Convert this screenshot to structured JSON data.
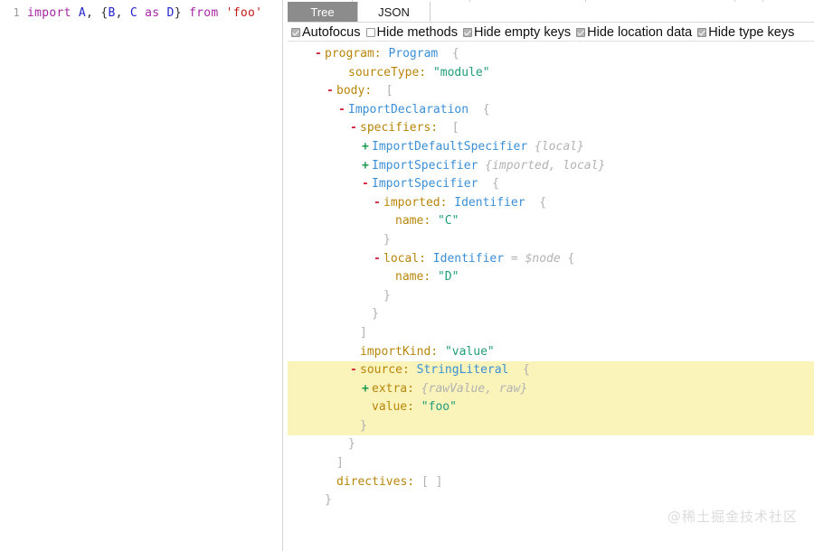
{
  "editor": {
    "lines": [
      {
        "number": "1",
        "tokens": [
          {
            "t": "import",
            "c": "kw"
          },
          {
            "t": " ",
            "c": "plain"
          },
          {
            "t": "A",
            "c": "id"
          },
          {
            "t": ", ",
            "c": "punc"
          },
          {
            "t": "{",
            "c": "punc"
          },
          {
            "t": "B",
            "c": "id"
          },
          {
            "t": ", ",
            "c": "punc"
          },
          {
            "t": "C",
            "c": "id"
          },
          {
            "t": " ",
            "c": "plain"
          },
          {
            "t": "as",
            "c": "kw"
          },
          {
            "t": " ",
            "c": "plain"
          },
          {
            "t": "D",
            "c": "id"
          },
          {
            "t": "}",
            "c": "punc"
          },
          {
            "t": " ",
            "c": "plain"
          },
          {
            "t": "from",
            "c": "kw"
          },
          {
            "t": " ",
            "c": "plain"
          },
          {
            "t": "'foo'",
            "c": "str"
          }
        ],
        "plain": "import A, {B, C as D} from 'foo'"
      }
    ]
  },
  "ast_panel": {
    "tabs": [
      {
        "label": "Tree",
        "active": true
      },
      {
        "label": "JSON",
        "active": false
      }
    ],
    "options": [
      {
        "label": "Autofocus",
        "checked": true
      },
      {
        "label": "Hide methods",
        "checked": false
      },
      {
        "label": "Hide empty keys",
        "checked": true
      },
      {
        "label": "Hide location data",
        "checked": true
      },
      {
        "label": "Hide type keys",
        "checked": true
      }
    ],
    "tree": [
      {
        "indent": 0,
        "toggle": "-",
        "parts": [
          {
            "t": "program",
            "c": "key"
          },
          {
            "t": ":",
            "c": "colon"
          },
          {
            "t": " ",
            "c": "plain"
          },
          {
            "t": "Program",
            "c": "type"
          },
          {
            "t": "  ",
            "c": "plain"
          },
          {
            "t": "{",
            "c": "brace"
          }
        ],
        "highlight": false
      },
      {
        "indent": 2,
        "toggle": " ",
        "parts": [
          {
            "t": "sourceType",
            "c": "key"
          },
          {
            "t": ":",
            "c": "colon"
          },
          {
            "t": " ",
            "c": "plain"
          },
          {
            "t": "\"module\"",
            "c": "str"
          }
        ],
        "highlight": false
      },
      {
        "indent": 1,
        "toggle": "-",
        "parts": [
          {
            "t": "body",
            "c": "key"
          },
          {
            "t": ":",
            "c": "colon"
          },
          {
            "t": "  ",
            "c": "plain"
          },
          {
            "t": "[",
            "c": "brace"
          }
        ],
        "highlight": false
      },
      {
        "indent": 2,
        "toggle": "-",
        "parts": [
          {
            "t": "ImportDeclaration",
            "c": "type"
          },
          {
            "t": "  ",
            "c": "plain"
          },
          {
            "t": "{",
            "c": "brace"
          }
        ],
        "highlight": false
      },
      {
        "indent": 3,
        "toggle": "-",
        "parts": [
          {
            "t": "specifiers",
            "c": "key"
          },
          {
            "t": ":",
            "c": "colon"
          },
          {
            "t": "  ",
            "c": "plain"
          },
          {
            "t": "[",
            "c": "brace"
          }
        ],
        "highlight": false
      },
      {
        "indent": 4,
        "toggle": "+",
        "parts": [
          {
            "t": "ImportDefaultSpecifier",
            "c": "type"
          },
          {
            "t": " ",
            "c": "plain"
          },
          {
            "t": "{local}",
            "c": "hint"
          }
        ],
        "highlight": false
      },
      {
        "indent": 4,
        "toggle": "+",
        "parts": [
          {
            "t": "ImportSpecifier",
            "c": "type"
          },
          {
            "t": " ",
            "c": "plain"
          },
          {
            "t": "{imported, local}",
            "c": "hint"
          }
        ],
        "highlight": false
      },
      {
        "indent": 4,
        "toggle": "-",
        "parts": [
          {
            "t": "ImportSpecifier",
            "c": "type"
          },
          {
            "t": "  ",
            "c": "plain"
          },
          {
            "t": "{",
            "c": "brace"
          }
        ],
        "highlight": false
      },
      {
        "indent": 5,
        "toggle": "-",
        "parts": [
          {
            "t": "imported",
            "c": "key"
          },
          {
            "t": ":",
            "c": "colon"
          },
          {
            "t": " ",
            "c": "plain"
          },
          {
            "t": "Identifier",
            "c": "type"
          },
          {
            "t": "  ",
            "c": "plain"
          },
          {
            "t": "{",
            "c": "brace"
          }
        ],
        "highlight": false
      },
      {
        "indent": 6,
        "toggle": " ",
        "parts": [
          {
            "t": "name",
            "c": "key"
          },
          {
            "t": ":",
            "c": "colon"
          },
          {
            "t": " ",
            "c": "plain"
          },
          {
            "t": "\"C\"",
            "c": "str"
          }
        ],
        "highlight": false
      },
      {
        "indent": 5,
        "toggle": " ",
        "parts": [
          {
            "t": "}",
            "c": "brace"
          }
        ],
        "highlight": false
      },
      {
        "indent": 5,
        "toggle": "-",
        "parts": [
          {
            "t": "local",
            "c": "key"
          },
          {
            "t": ":",
            "c": "colon"
          },
          {
            "t": " ",
            "c": "plain"
          },
          {
            "t": "Identifier",
            "c": "type"
          },
          {
            "t": " ",
            "c": "plain"
          },
          {
            "t": "=",
            "c": "eq"
          },
          {
            "t": " ",
            "c": "plain"
          },
          {
            "t": "$node",
            "c": "hint"
          },
          {
            "t": " ",
            "c": "plain"
          },
          {
            "t": "{",
            "c": "brace"
          }
        ],
        "highlight": false
      },
      {
        "indent": 6,
        "toggle": " ",
        "parts": [
          {
            "t": "name",
            "c": "key"
          },
          {
            "t": ":",
            "c": "colon"
          },
          {
            "t": " ",
            "c": "plain"
          },
          {
            "t": "\"D\"",
            "c": "str"
          }
        ],
        "highlight": false
      },
      {
        "indent": 5,
        "toggle": " ",
        "parts": [
          {
            "t": "}",
            "c": "brace"
          }
        ],
        "highlight": false
      },
      {
        "indent": 4,
        "toggle": " ",
        "parts": [
          {
            "t": "}",
            "c": "brace"
          }
        ],
        "highlight": false
      },
      {
        "indent": 3,
        "toggle": " ",
        "parts": [
          {
            "t": "]",
            "c": "brace"
          }
        ],
        "highlight": false
      },
      {
        "indent": 3,
        "toggle": " ",
        "parts": [
          {
            "t": "importKind",
            "c": "key"
          },
          {
            "t": ":",
            "c": "colon"
          },
          {
            "t": " ",
            "c": "plain"
          },
          {
            "t": "\"value\"",
            "c": "str"
          }
        ],
        "highlight": false
      },
      {
        "indent": 3,
        "toggle": "-",
        "parts": [
          {
            "t": "source",
            "c": "key"
          },
          {
            "t": ":",
            "c": "colon"
          },
          {
            "t": " ",
            "c": "plain"
          },
          {
            "t": "StringLiteral",
            "c": "type"
          },
          {
            "t": "  ",
            "c": "plain"
          },
          {
            "t": "{",
            "c": "brace"
          }
        ],
        "highlight": true
      },
      {
        "indent": 4,
        "toggle": "+",
        "parts": [
          {
            "t": "extra",
            "c": "key"
          },
          {
            "t": ":",
            "c": "colon"
          },
          {
            "t": " ",
            "c": "plain"
          },
          {
            "t": "{rawValue, raw}",
            "c": "hint"
          }
        ],
        "highlight": true
      },
      {
        "indent": 4,
        "toggle": " ",
        "parts": [
          {
            "t": "value",
            "c": "key"
          },
          {
            "t": ":",
            "c": "colon"
          },
          {
            "t": " ",
            "c": "plain"
          },
          {
            "t": "\"foo\"",
            "c": "str"
          }
        ],
        "highlight": true
      },
      {
        "indent": 3,
        "toggle": " ",
        "parts": [
          {
            "t": "}",
            "c": "brace"
          }
        ],
        "highlight": true
      },
      {
        "indent": 2,
        "toggle": " ",
        "parts": [
          {
            "t": "}",
            "c": "brace"
          }
        ],
        "highlight": false
      },
      {
        "indent": 1,
        "toggle": " ",
        "parts": [
          {
            "t": "]",
            "c": "brace"
          }
        ],
        "highlight": false
      },
      {
        "indent": 1,
        "toggle": " ",
        "parts": [
          {
            "t": "directives",
            "c": "key"
          },
          {
            "t": ":",
            "c": "colon"
          },
          {
            "t": " ",
            "c": "plain"
          },
          {
            "t": "[ ]",
            "c": "brace"
          }
        ],
        "highlight": false
      },
      {
        "indent": 0,
        "toggle": " ",
        "parts": [
          {
            "t": "}",
            "c": "brace"
          }
        ],
        "highlight": false
      }
    ]
  },
  "watermark": {
    "text": "@稀土掘金技术社区"
  },
  "colors": {
    "key": "#b8860b",
    "type": "#3b8fd6",
    "string": "#1f9d7a",
    "hint": "#b3b3b3",
    "toggle_expand": "#d2283c",
    "toggle_collapse": "#1a9850",
    "highlight_bg": "#faf3ba",
    "active_tab_bg": "#8c8c8c",
    "code_keyword": "#a626a4",
    "code_identifier": "#2222cc",
    "code_string": "#c41a16"
  }
}
